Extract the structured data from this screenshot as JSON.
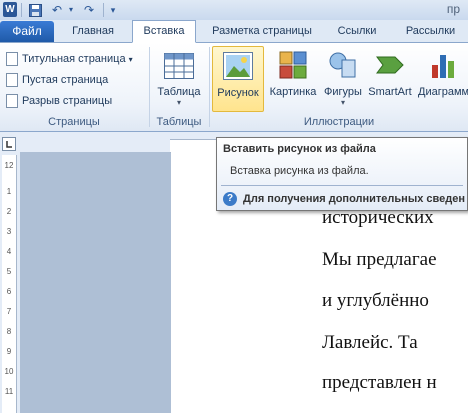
{
  "titlebar": {
    "title": "пр",
    "icons": [
      "word-icon",
      "save-icon",
      "undo-icon",
      "redo-icon",
      "customize-icon"
    ]
  },
  "tabs": [
    {
      "label": "Файл"
    },
    {
      "label": "Главная"
    },
    {
      "label": "Вставка"
    },
    {
      "label": "Разметка страницы"
    },
    {
      "label": "Ссылки"
    },
    {
      "label": "Рассылки"
    }
  ],
  "ribbon": {
    "pages_group": {
      "label": "Страницы",
      "cover_page": "Титульная страница",
      "blank_page": "Пустая страница",
      "page_break": "Разрыв страницы"
    },
    "tables_group": {
      "label": "Таблицы",
      "table": "Таблица"
    },
    "illustrations_group": {
      "label": "Иллюстрации",
      "picture": "Рисунок",
      "clipart": "Картинка",
      "shapes": "Фигуры",
      "smartart": "SmartArt",
      "chart": "Диаграмм"
    }
  },
  "tooltip": {
    "title": "Вставить рисунок из файла",
    "description": "Вставка рисунка из файла.",
    "help": "Для получения дополнительных сведен"
  },
  "ruler": {
    "vertical_numbers": [
      "12",
      "1",
      "2",
      "3",
      "4",
      "5",
      "6",
      "7",
      "8",
      "9",
      "10",
      "11"
    ]
  },
  "document": {
    "lines": [
      "исторических",
      "Мы предлагае",
      "и   углублённо",
      "Лавлейс.   Та",
      "представлен н"
    ]
  },
  "colors": {
    "file_tab": "#2b6cc4",
    "hover": "#ffe48e",
    "ribbon_text": "#1e395b"
  }
}
